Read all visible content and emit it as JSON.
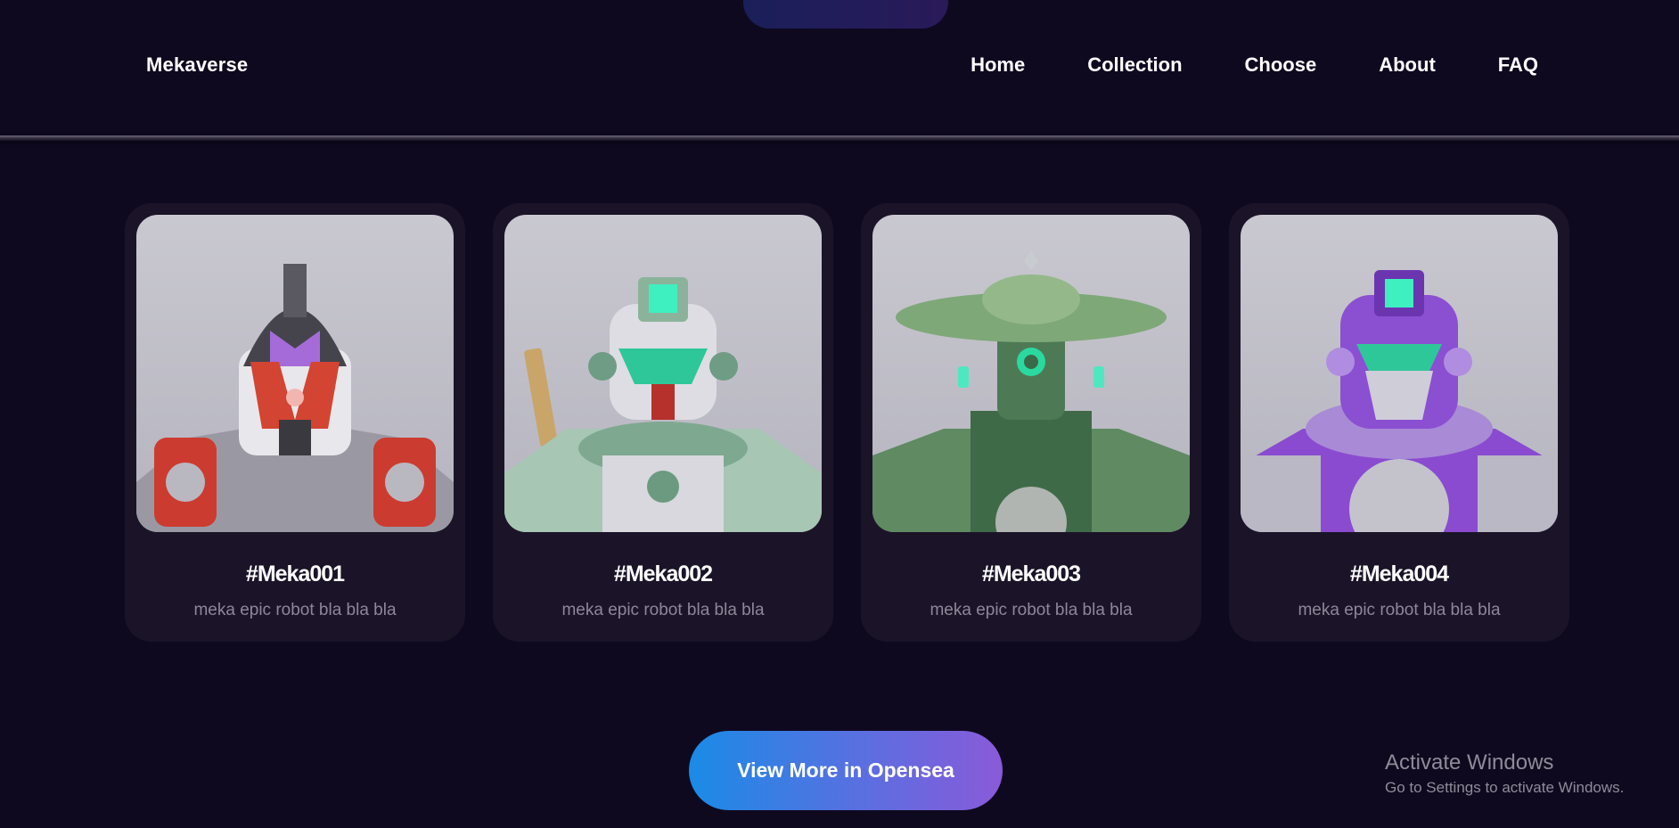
{
  "navbar": {
    "brand": "Mekaverse",
    "links": [
      "Home",
      "Collection",
      "Choose",
      "About",
      "FAQ"
    ]
  },
  "cards": [
    {
      "title": "#Meka001",
      "description": "meka epic robot bla bla bla",
      "accent": "#d0443a"
    },
    {
      "title": "#Meka002",
      "description": "meka epic robot bla bla bla",
      "accent": "#7fb49a"
    },
    {
      "title": "#Meka003",
      "description": "meka epic robot bla bla bla",
      "accent": "#4f8a5a"
    },
    {
      "title": "#Meka004",
      "description": "meka epic robot bla bla bla",
      "accent": "#8a4bd0"
    }
  ],
  "cta": {
    "label": "View More in Opensea"
  },
  "watermark": {
    "title": "Activate Windows",
    "subtitle": "Go to Settings to activate Windows."
  },
  "colors": {
    "background": "#0f0920",
    "card": "#1b1428",
    "cta_start": "#1a8be6",
    "cta_end": "#8a5ad9"
  }
}
